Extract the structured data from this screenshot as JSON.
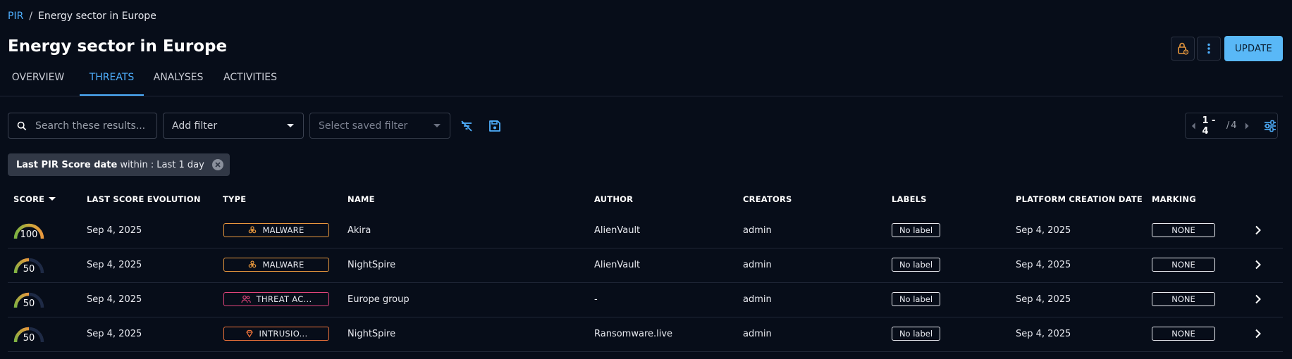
{
  "breadcrumb": {
    "root": "PIR",
    "separator": "/",
    "current": "Energy sector in Europe"
  },
  "page": {
    "title": "Energy sector in Europe"
  },
  "actions": {
    "update_label": "UPDATE"
  },
  "tabs": [
    {
      "label": "OVERVIEW"
    },
    {
      "label": "THREATS"
    },
    {
      "label": "ANALYSES"
    },
    {
      "label": "ACTIVITIES"
    }
  ],
  "active_tab": "THREATS",
  "toolbar": {
    "search_placeholder": "Search these results...",
    "add_filter_label": "Add filter",
    "saved_filter_placeholder": "Select saved filter"
  },
  "pagination": {
    "range": "1 - 4",
    "separator": "/",
    "total": "4"
  },
  "active_filter": {
    "key": "Last PIR Score date",
    "operator": "within :",
    "value": "Last 1 day"
  },
  "table": {
    "columns": [
      "SCORE",
      "LAST SCORE EVOLUTION",
      "TYPE",
      "NAME",
      "AUTHOR",
      "CREATORS",
      "LABELS",
      "PLATFORM CREATION DATE",
      "MARKING"
    ],
    "rows": [
      {
        "score": "100",
        "score_value": 100,
        "last_score_evolution": "Sep 4, 2025",
        "type": "MALWARE",
        "type_icon": "biohazard-icon",
        "name": "Akira",
        "author": "AlienVault",
        "creators": "admin",
        "label": "No label",
        "created": "Sep 4, 2025",
        "marking": "NONE"
      },
      {
        "score": "50",
        "score_value": 50,
        "last_score_evolution": "Sep 4, 2025",
        "type": "MALWARE",
        "type_icon": "biohazard-icon",
        "name": "NightSpire",
        "author": "AlienVault",
        "creators": "admin",
        "label": "No label",
        "created": "Sep 4, 2025",
        "marking": "NONE"
      },
      {
        "score": "50",
        "score_value": 50,
        "last_score_evolution": "Sep 4, 2025",
        "type": "THREAT AC...",
        "type_icon": "people-icon",
        "name": "Europe group",
        "author": "-",
        "creators": "admin",
        "label": "No label",
        "created": "Sep 4, 2025",
        "marking": "NONE"
      },
      {
        "score": "50",
        "score_value": 50,
        "last_score_evolution": "Sep 4, 2025",
        "type": "INTRUSIO...",
        "type_icon": "diamond-icon",
        "name": "NightSpire",
        "author": "Ransomware.live",
        "creators": "admin",
        "label": "No label",
        "created": "Sep 4, 2025",
        "marking": "NONE"
      }
    ]
  },
  "colors": {
    "accent": "#4fb0ff",
    "update_button": "#59b8f7",
    "malware": "#e8983d",
    "threat_actor": "#e0457b",
    "intrusion_set": "#f0743a",
    "lock_icon": "#e8983d",
    "gauge_track": "#1e2a45"
  },
  "icons": {
    "search": "search-icon",
    "lock": "lock-icon",
    "menu": "more-vertical-icon",
    "dropdown": "caret-down-icon",
    "clear_filters": "filter-off-icon",
    "save_filter": "save-icon",
    "prev_page": "chevron-left-icon",
    "next_page": "chevron-right-icon",
    "settings": "sliders-icon",
    "remove": "close-circle-icon",
    "row_open": "chevron-right-icon"
  }
}
